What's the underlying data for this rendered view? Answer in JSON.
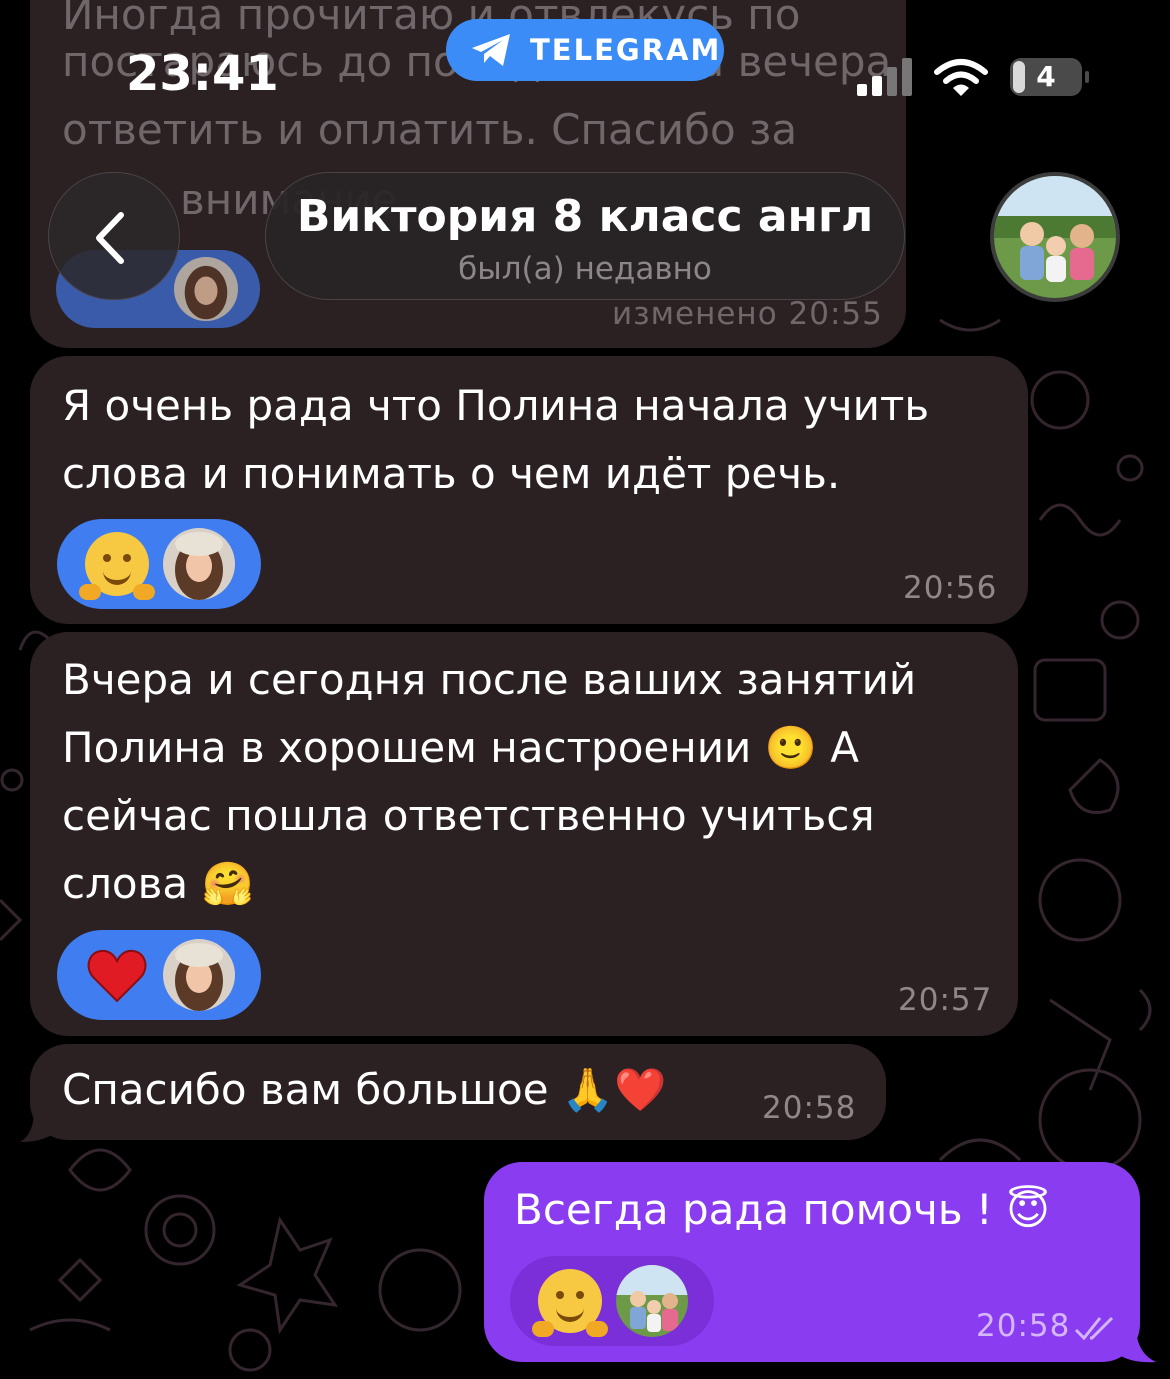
{
  "status_bar": {
    "time": "23:41",
    "battery": "4",
    "icons": [
      "signal-icon",
      "wifi-icon",
      "battery-icon"
    ]
  },
  "telegram_banner": {
    "label": "TELEGRAM",
    "icon": "telegram-plane-icon"
  },
  "header": {
    "title": "Виктория 8 класс англ",
    "subtitle": "был(а) недавно"
  },
  "top_message": {
    "line1": "Иногда прочитаю и отвлекусь по",
    "line2": "постараюсь до понедельника вечера",
    "line3": "ответить и оплатить. Спасибо за",
    "line4": "внимание",
    "time": "изменено 20:55"
  },
  "messages": [
    {
      "text": "Я очень рада что Полина начала учить\nслова и понимать о чем идёт речь.",
      "reaction": "hugging-face",
      "time": "20:56"
    },
    {
      "text": "Вчера и сегодня после ваших занятий\nПолина в хорошем настроении 🙂 А\nсейчас пошла ответственно учиться\nслова 🤗",
      "reaction": "red-heart",
      "time": "20:57"
    },
    {
      "text": "Спасибо вам большое 🙏❤️",
      "time": "20:58"
    }
  ],
  "outgoing": {
    "text": "Всегда рада помочь ! 😇",
    "reaction": "hugging-face",
    "time": "20:58",
    "read_icon": "double-check-icon"
  },
  "colors": {
    "incoming_bubble": "#2b2123",
    "outgoing_bubble": "#8a3cf0",
    "reaction_incoming": "#3f7df0",
    "reaction_outgoing": "#7a2fd8",
    "telegram_blue": "#3b8cf7"
  }
}
